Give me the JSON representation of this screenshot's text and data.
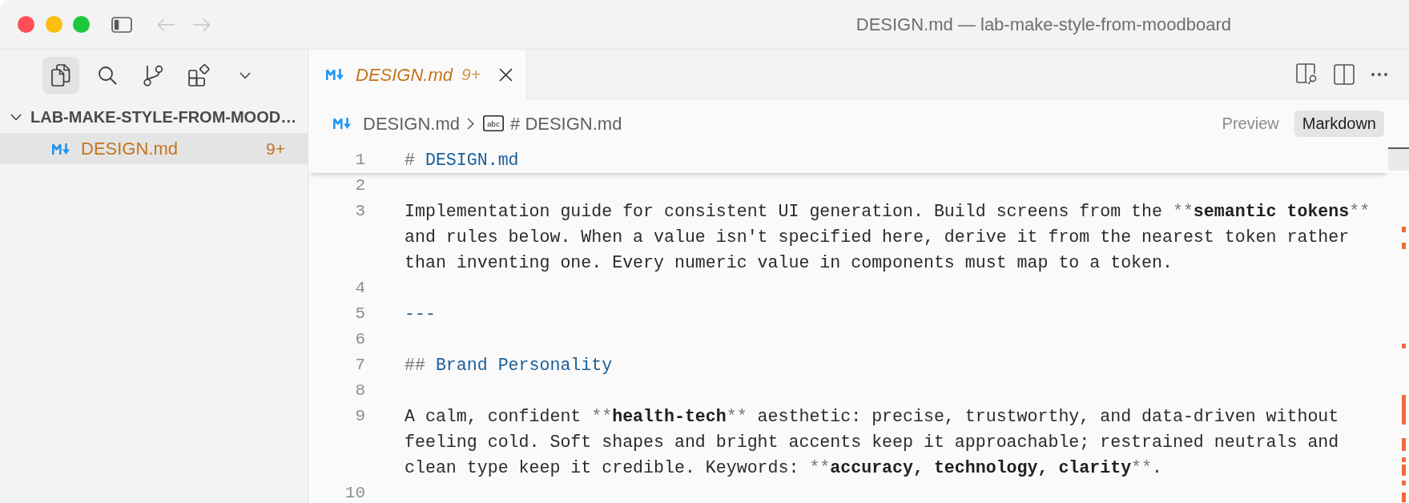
{
  "window": {
    "title": "DESIGN.md — lab-make-style-from-moodboard"
  },
  "navigation": [
    {
      "kind": "back",
      "disabled": true
    },
    {
      "kind": "forward",
      "disabled": true
    }
  ],
  "activity_bar": [
    {
      "kind": "explorer",
      "selected": true
    },
    {
      "kind": "search",
      "selected": false
    },
    {
      "kind": "source_control",
      "selected": false
    },
    {
      "kind": "extensions",
      "selected": false
    }
  ],
  "explorer": {
    "folder": {
      "name": "LAB-MAKE-STYLE-FROM-MOOD…",
      "expanded": true,
      "children": [
        {
          "name": "DESIGN.md",
          "badge": "9+",
          "warning": true,
          "selected": true
        }
      ]
    }
  },
  "tabs": [
    {
      "label": "DESIGN.md",
      "badge": "9+",
      "warning": true,
      "preview": true,
      "selected": true
    }
  ],
  "breadcrumb": [
    {
      "kind": "file",
      "label": "DESIGN.md"
    },
    {
      "kind": "symbol",
      "icon_text": "abc",
      "label": "# DESIGN.md"
    }
  ],
  "view_modes": [
    {
      "label": "Preview",
      "selected": false
    },
    {
      "label": "Markdown",
      "selected": true
    }
  ],
  "editor": {
    "sticky_scroll": [
      {
        "number": "1",
        "segments": [
          {
            "kind": "syntax",
            "text": "# "
          },
          {
            "kind": "heading",
            "text": "DESIGN.md"
          }
        ]
      }
    ],
    "lines": [
      {
        "number": "2"
      },
      {
        "number": "3",
        "segments": [
          {
            "kind": "plain",
            "text": "Implementation guide for consistent UI generation. Build screens from the "
          },
          {
            "kind": "syntax",
            "text": "**"
          },
          {
            "kind": "bold",
            "text": "semantic tokens"
          },
          {
            "kind": "syntax",
            "text": "**"
          },
          {
            "kind": "plain",
            "text": " and rules below. When a value isn't specified here, derive it from the nearest token rather than inventing one. Every numeric value in components must map to a token."
          }
        ]
      },
      {
        "number": "4"
      },
      {
        "number": "5",
        "segments": [
          {
            "kind": "heading",
            "text": "---"
          }
        ]
      },
      {
        "number": "6"
      },
      {
        "number": "7",
        "segments": [
          {
            "kind": "syntax",
            "text": "## "
          },
          {
            "kind": "heading",
            "text": "Brand Personality"
          }
        ]
      },
      {
        "number": "8"
      },
      {
        "number": "9",
        "segments": [
          {
            "kind": "plain",
            "text": "A calm, confident "
          },
          {
            "kind": "syntax",
            "text": "**"
          },
          {
            "kind": "bold",
            "text": "health-tech"
          },
          {
            "kind": "syntax",
            "text": "**"
          },
          {
            "kind": "plain",
            "text": " aesthetic: precise, trustworthy, and data-driven without feeling cold. Soft shapes and bright accents keep it approachable; restrained neutrals and clean type keep it credible. Keywords: "
          },
          {
            "kind": "syntax",
            "text": "**"
          },
          {
            "kind": "bold",
            "text": "accuracy, technology, clarity"
          },
          {
            "kind": "syntax",
            "text": "**"
          },
          {
            "kind": "plain",
            "text": "."
          }
        ]
      },
      {
        "number": "10"
      }
    ]
  }
}
